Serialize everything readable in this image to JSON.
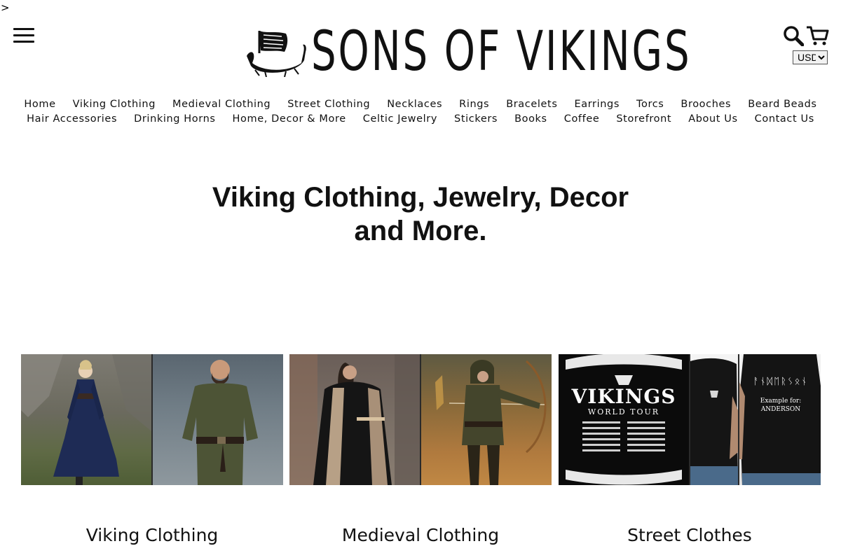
{
  "stray_char": ">",
  "header": {
    "logo_text": "SONS OF VIKINGS",
    "currency": {
      "selected": "USD",
      "options": [
        "USD"
      ]
    }
  },
  "nav": {
    "row1": [
      "Home",
      "Viking Clothing",
      "Medieval Clothing",
      "Street Clothing",
      "Necklaces",
      "Rings",
      "Bracelets",
      "Earrings",
      "Torcs",
      "Brooches",
      "Beard Beads"
    ],
    "row2": [
      "Hair Accessories",
      "Drinking Horns",
      "Home, Decor & More",
      "Celtic Jewelry",
      "Stickers",
      "Books",
      "Coffee",
      "Storefront",
      "About Us",
      "Contact Us"
    ]
  },
  "hero": {
    "title": "Viking Clothing, Jewelry, Decor and More."
  },
  "cards": [
    {
      "label": "Viking Clothing"
    },
    {
      "label": "Medieval Clothing"
    },
    {
      "label": "Street Clothes"
    }
  ],
  "street_image": {
    "tour_title": "VIKINGS",
    "tour_subtitle": "WORLD TOUR",
    "shirt_runes": "ᚨᚾᛞᛖᚱᛊᛟᚾ",
    "shirt_example_label": "Example for:",
    "shirt_example_name": "ANDERSON"
  },
  "colors": {
    "text": "#111111",
    "background": "#ffffff"
  }
}
